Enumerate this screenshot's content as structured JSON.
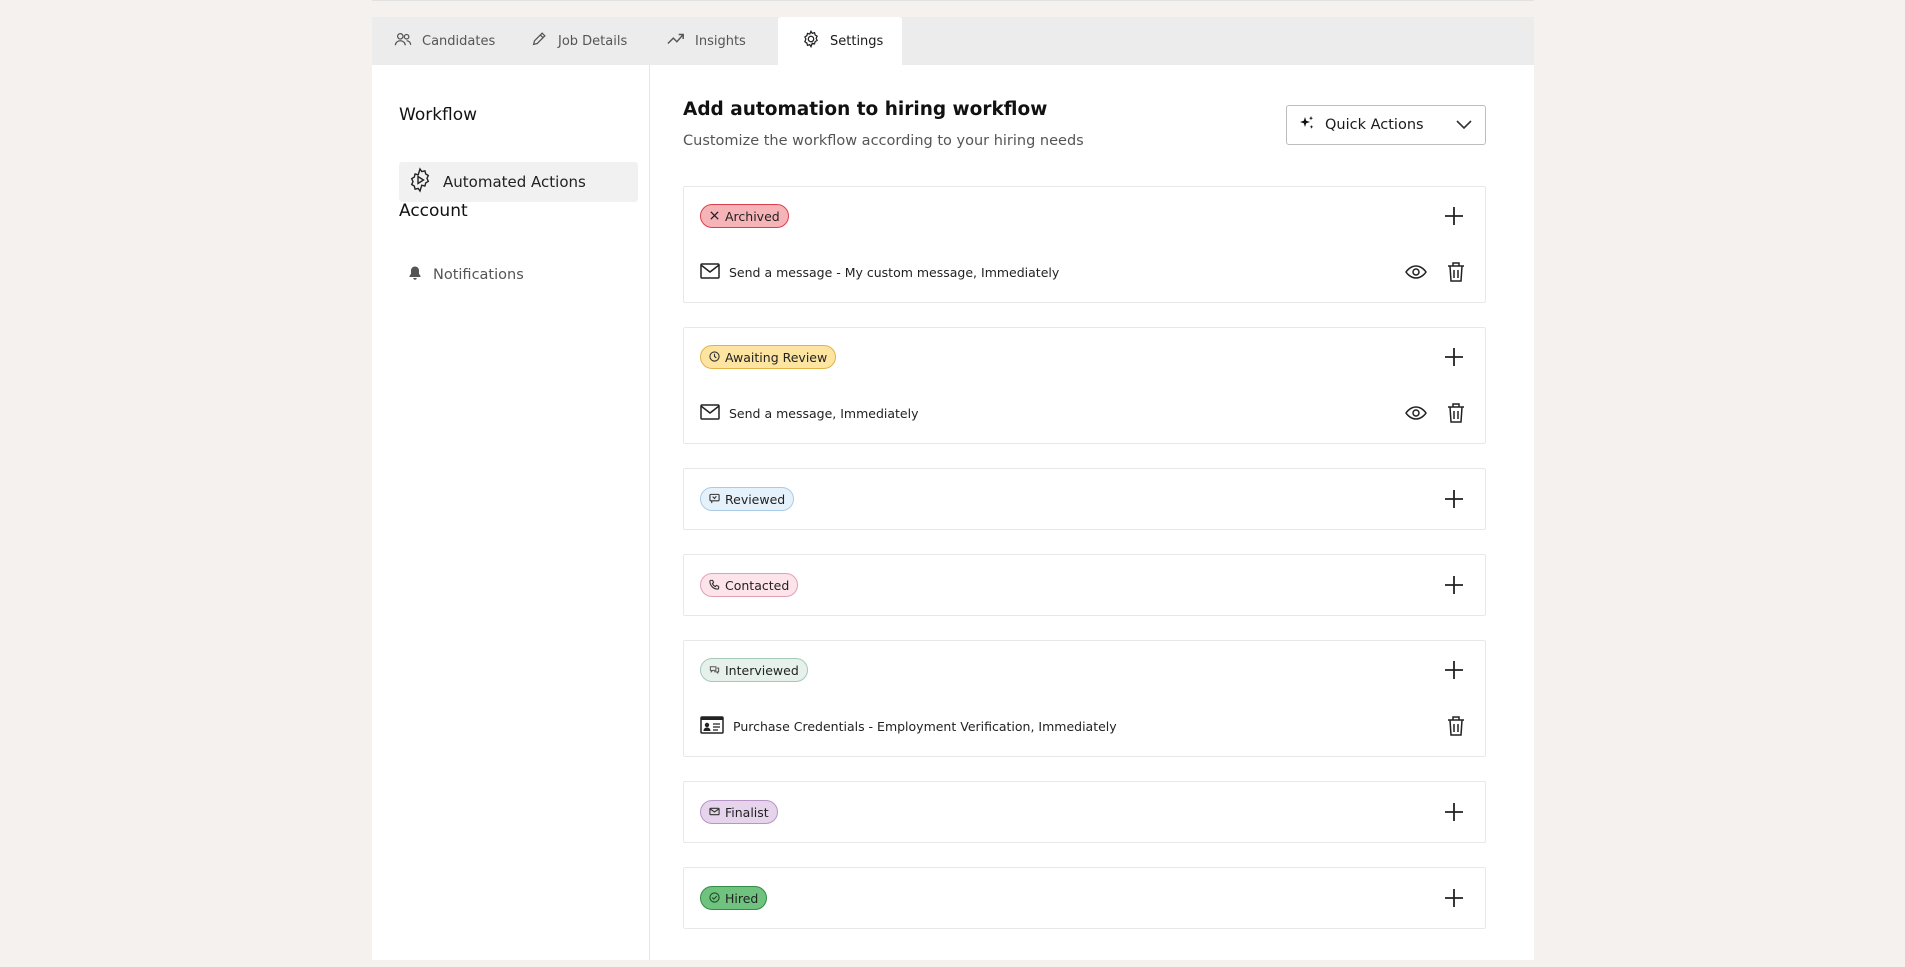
{
  "tabs": [
    {
      "label": "Candidates",
      "icon": "users-icon"
    },
    {
      "label": "Job Details",
      "icon": "pencil-icon"
    },
    {
      "label": "Insights",
      "icon": "trend-icon"
    },
    {
      "label": "Settings",
      "icon": "gear-icon",
      "active": true
    }
  ],
  "sidebar": {
    "workflow_heading": "Workflow",
    "automated_actions": "Automated Actions",
    "account_heading": "Account",
    "notifications": "Notifications"
  },
  "main": {
    "title": "Add automation to hiring workflow",
    "subtitle": "Customize the workflow according to your hiring needs",
    "quick_actions": "Quick Actions"
  },
  "stages": [
    {
      "label": "Archived",
      "color": "#f7b4b8",
      "border": "#d9404b",
      "icon": "x-icon",
      "actions": [
        {
          "text": "Send a message - My custom message, Immediately",
          "icon": "mail-icon",
          "view": true
        }
      ]
    },
    {
      "label": "Awaiting Review",
      "color": "#fde4a0",
      "border": "#e0b24a",
      "icon": "clock-icon",
      "actions": [
        {
          "text": "Send a message, Immediately",
          "icon": "mail-icon",
          "view": true
        }
      ]
    },
    {
      "label": "Reviewed",
      "color": "#e6f2fb",
      "border": "#a9cbe6",
      "icon": "flag-icon",
      "actions": []
    },
    {
      "label": "Contacted",
      "color": "#fde3ea",
      "border": "#e2a0b3",
      "icon": "phone-icon",
      "actions": []
    },
    {
      "label": "Interviewed",
      "color": "#e6f1ec",
      "border": "#a6c8b8",
      "icon": "chat-icon",
      "actions": [
        {
          "text": "Purchase Credentials - Employment Verification, Immediately",
          "icon": "id-card-icon",
          "view": false
        }
      ]
    },
    {
      "label": "Finalist",
      "color": "#e6d3ec",
      "border": "#b795c6",
      "icon": "mail-icon",
      "actions": []
    },
    {
      "label": "Hired",
      "color": "#6fc37f",
      "border": "#2f8d44",
      "icon": "check-circle-icon",
      "actions": []
    }
  ]
}
